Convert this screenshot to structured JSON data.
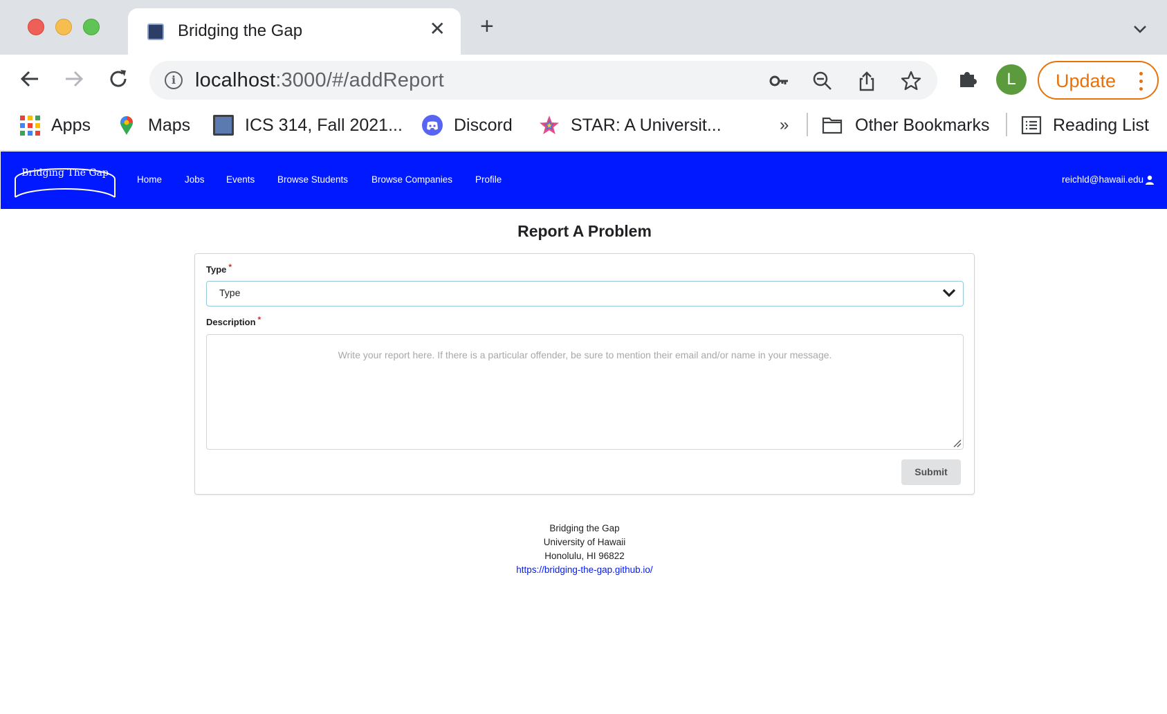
{
  "browser": {
    "tab_title": "Bridging the Gap",
    "url_host": "localhost",
    "url_path": ":3000/#/addReport",
    "profile_initial": "L",
    "update_label": "Update",
    "bookmarks": [
      {
        "label": "Apps",
        "icon": "apps-grid-icon"
      },
      {
        "label": "Maps",
        "icon": "maps-pin-icon"
      },
      {
        "label": "ICS 314, Fall 2021...",
        "icon": "bookmark-page-icon"
      },
      {
        "label": "Discord",
        "icon": "discord-icon"
      },
      {
        "label": "STAR: A Universit...",
        "icon": "star-logo-icon"
      }
    ],
    "bookmarks_overflow": "»",
    "other_bookmarks": "Other Bookmarks",
    "reading_list": "Reading List"
  },
  "navbar": {
    "logo_text": "Bridging The Gap",
    "links": [
      "Home",
      "Jobs",
      "Events",
      "Browse Students",
      "Browse Companies",
      "Profile"
    ],
    "user_email": "reichld@hawaii.edu"
  },
  "form": {
    "title": "Report A Problem",
    "type_label": "Type",
    "type_value": "Type",
    "description_label": "Description",
    "required_marker": "*",
    "description_placeholder": "Write your report here. If there is a particular offender, be sure to mention their email and/or name in your message.",
    "submit_label": "Submit"
  },
  "footer": {
    "line1": "Bridging the Gap",
    "line2": "University of Hawaii",
    "line3": "Honolulu, HI 96822",
    "link": "https://bridging-the-gap.github.io/"
  },
  "colors": {
    "navbar_bg": "#0019ff",
    "update_accent": "#e8710a",
    "required": "#db2828",
    "select_border": "#96c8da"
  }
}
